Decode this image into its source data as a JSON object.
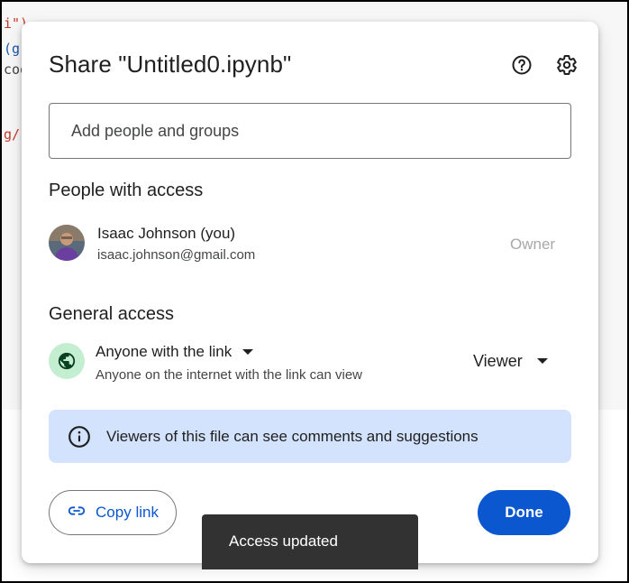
{
  "background_code": {
    "line1": "i\")",
    "line2": "(g",
    "line3": "coo",
    "line4": "g/"
  },
  "dialog": {
    "title": "Share \"Untitled0.ipynb\"",
    "help_icon": "help-circle-icon",
    "settings_icon": "gear-icon",
    "add_people_placeholder": "Add people and groups",
    "people_heading": "People with access",
    "person": {
      "name": "Isaac Johnson (you)",
      "email": "isaac.johnson@gmail.com",
      "role": "Owner"
    },
    "general_heading": "General access",
    "general": {
      "icon": "globe-icon",
      "scope": "Anyone with the link",
      "description": "Anyone on the internet with the link can view",
      "role": "Viewer"
    },
    "info_banner": {
      "icon": "info-icon",
      "text": "Viewers of this file can see comments and suggestions"
    },
    "copy_link_label": "Copy link",
    "done_label": "Done"
  },
  "snackbar": {
    "text": "Access updated"
  },
  "colors": {
    "primary": "#0b57d0",
    "banner": "#d3e3fd",
    "globe_bg": "#c4eed0",
    "snackbar_bg": "#323232"
  }
}
